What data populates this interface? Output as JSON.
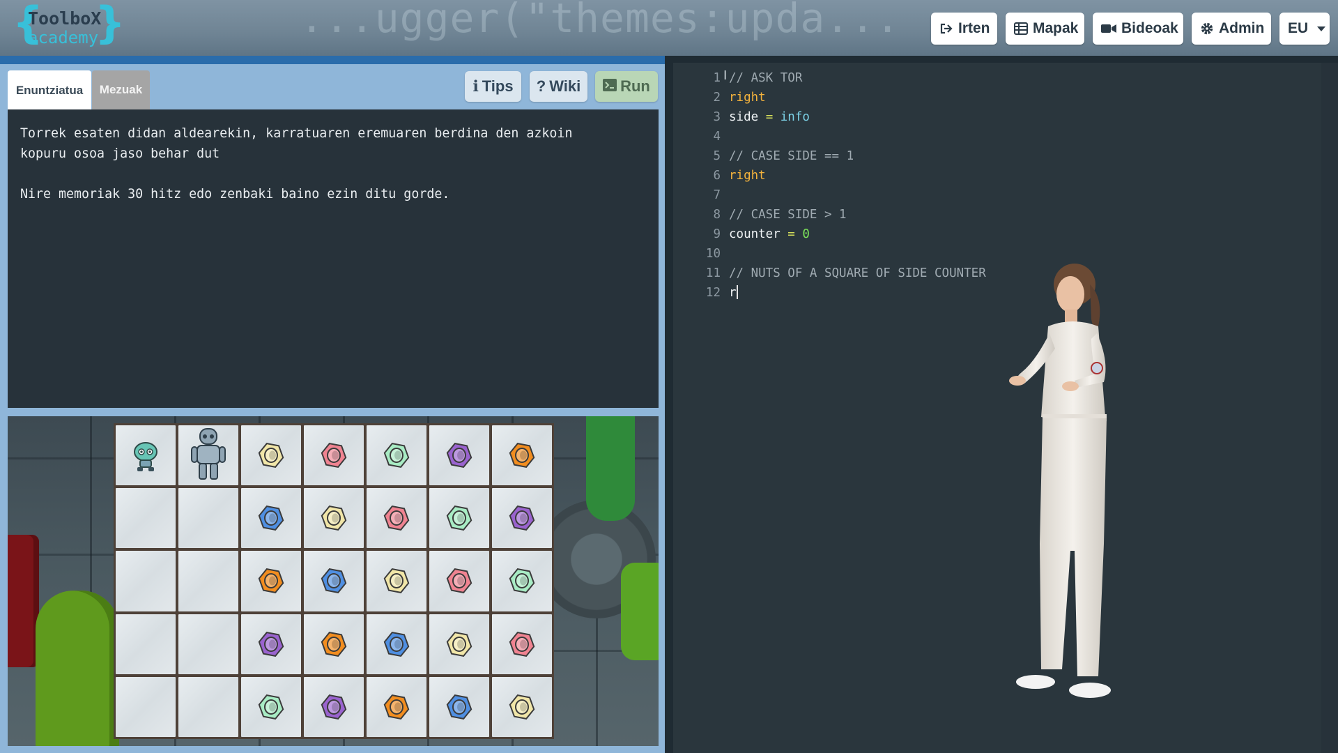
{
  "header": {
    "logo_line1": "ToolboX",
    "logo_line2": "academy",
    "background_code_1": "...ugger(\"themes:upda...",
    "nav": {
      "irten": "Irten",
      "mapak": "Mapak",
      "bideoak": "Bideoak",
      "admin": "Admin",
      "language": "EU"
    }
  },
  "tabs": {
    "statement": "Enuntziatua",
    "messages": "Mezuak"
  },
  "buttons": {
    "tips": "Tips",
    "wiki": "Wiki",
    "run": "Run"
  },
  "statement": {
    "paragraph1": "Torrek esaten didan aldearekin, karratuaren eremuaren berdina den azkoin\nkopuru osoa jaso behar dut",
    "paragraph2": "Nire memoriak 30 hitz edo zenbaki baino ezin ditu gorde."
  },
  "board": {
    "rows": [
      [
        "robot",
        "tor",
        "yellow",
        "red",
        "green",
        "purple",
        "orange"
      ],
      [
        "empty",
        "empty",
        "blue",
        "yellow",
        "red",
        "green",
        "purple"
      ],
      [
        "empty",
        "empty",
        "orange",
        "blue",
        "yellow",
        "red",
        "green"
      ],
      [
        "empty",
        "empty",
        "purple",
        "orange",
        "blue",
        "yellow",
        "red"
      ],
      [
        "empty",
        "empty",
        "green",
        "purple",
        "orange",
        "blue",
        "yellow"
      ]
    ],
    "nut_colors": {
      "yellow": "#f1e6a8",
      "red": "#f08391",
      "green": "#a8ecc4",
      "purple": "#9a63cf",
      "orange": "#f28d1f",
      "blue": "#4f8fe2"
    }
  },
  "editor": {
    "lines": [
      {
        "n": "1",
        "text": "// ASK TOR",
        "type": "comment"
      },
      {
        "n": "2",
        "text": "right",
        "type": "keyword"
      },
      {
        "n": "3",
        "text": "side = info",
        "type": "assign"
      },
      {
        "n": "4",
        "text": "",
        "type": "blank"
      },
      {
        "n": "5",
        "text": "// CASE SIDE == 1",
        "type": "comment"
      },
      {
        "n": "6",
        "text": "right",
        "type": "keyword"
      },
      {
        "n": "7",
        "text": "",
        "type": "blank"
      },
      {
        "n": "8",
        "text": "// CASE SIDE > 1",
        "type": "comment"
      },
      {
        "n": "9",
        "text": "counter = 0",
        "type": "assign"
      },
      {
        "n": "10",
        "text": "",
        "type": "blank"
      },
      {
        "n": "11",
        "text": "// NUTS OF A SQUARE OF SIDE COUNTER",
        "type": "comment"
      },
      {
        "n": "12",
        "text": "r",
        "type": "typing"
      }
    ],
    "tokens": {
      "side": "side",
      "eq": " = ",
      "info": "info",
      "counter": "counter",
      "zero": "0"
    }
  }
}
